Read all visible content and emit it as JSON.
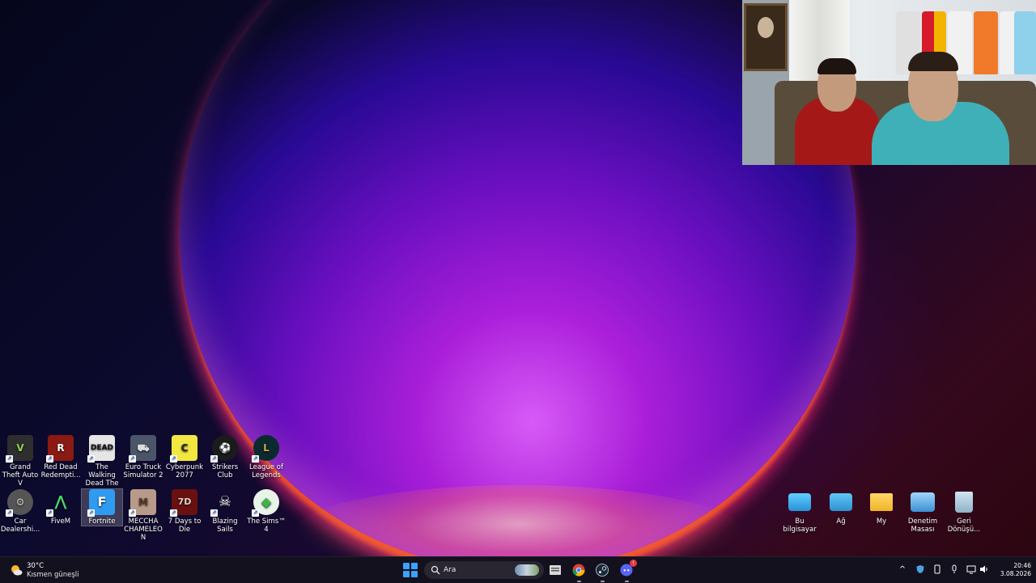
{
  "desktop": {
    "left_icons": [
      {
        "label": "Grand Theft Auto V",
        "icon": "gta-v-icon",
        "color": "#2e2e2e"
      },
      {
        "label": "Red Dead Redempti...",
        "icon": "red-dead-redemption-icon",
        "color": "#8a1a12"
      },
      {
        "label": "The Walking Dead The ...",
        "icon": "walking-dead-icon",
        "color": "#e6e6e6"
      },
      {
        "label": "Euro Truck Simulator 2",
        "icon": "euro-truck-icon",
        "color": "#4a5568"
      },
      {
        "label": "Cyberpunk 2077",
        "icon": "cyberpunk-icon",
        "color": "#f2e640"
      },
      {
        "label": "Strikers Club",
        "icon": "strikers-club-icon",
        "color": "#1b1b1b"
      },
      {
        "label": "League of Legends",
        "icon": "league-of-legends-icon",
        "color": "#0a2a2e"
      },
      {
        "label": "Car Dealershi...",
        "icon": "car-dealership-icon",
        "color": "#555555"
      },
      {
        "label": "FiveM",
        "icon": "fivem-icon",
        "color": "#0e1a10"
      },
      {
        "label": "Fortnite",
        "icon": "fortnite-icon",
        "color": "#2f9bf0"
      },
      {
        "label": "MECCHA CHAMELEON",
        "icon": "meccha-chameleon-icon",
        "color": "#b89a88"
      },
      {
        "label": "7 Days to Die",
        "icon": "seven-days-to-die-icon",
        "color": "#6a1010"
      },
      {
        "label": "Blazing Sails",
        "icon": "blazing-sails-icon",
        "color": "#1d1d1d"
      },
      {
        "label": "The Sims™ 4",
        "icon": "sims-4-icon",
        "color": "#3cb44a"
      }
    ],
    "right_icons": [
      {
        "label": "Bu bilgisayar",
        "icon": "this-pc-icon",
        "color": "#3ab0e8"
      },
      {
        "label": "Ağ",
        "icon": "network-icon",
        "color": "#2f8fd0"
      },
      {
        "label": "My",
        "icon": "folder-icon",
        "color": "#f4c542"
      },
      {
        "label": "Denetim Masası",
        "icon": "control-panel-icon",
        "color": "#55a8e0"
      },
      {
        "label": "Geri Dönüşü...",
        "icon": "recycle-bin-icon",
        "color": "#9fc4d8"
      }
    ]
  },
  "taskbar": {
    "weather": {
      "temp": "30°C",
      "desc": "Kısmen güneşli",
      "icon": "partly-sunny-icon"
    },
    "search": {
      "placeholder": "Ara"
    },
    "apps": [
      {
        "name": "file-explorer",
        "icon": "file-explorer-icon"
      },
      {
        "name": "chrome",
        "icon": "chrome-icon"
      },
      {
        "name": "steam",
        "icon": "steam-icon"
      },
      {
        "name": "discord",
        "icon": "discord-icon",
        "badge": "!"
      }
    ],
    "tray": {
      "icons": [
        "chevron-up-icon",
        "shield-icon",
        "usb-icon",
        "microphone-icon",
        "display-icon",
        "speaker-icon"
      ]
    },
    "clock": {
      "time": "20:46",
      "date": "3.08.2026"
    }
  },
  "colors": {
    "accent": "#3aa2ff",
    "taskbar": "#16121e"
  }
}
